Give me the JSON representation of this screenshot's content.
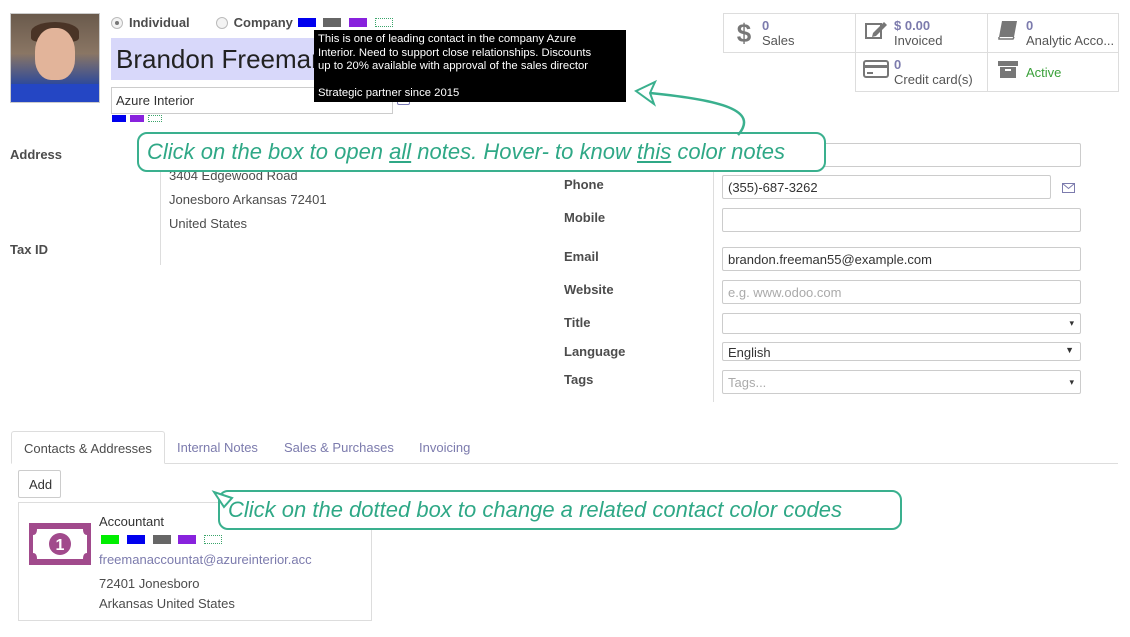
{
  "contact": {
    "type_individual": "Individual",
    "type_company": "Company",
    "name": "Brandon Freeman",
    "company": "Azure Interior",
    "tag_colors": [
      "#0000ee",
      "#666666",
      "#8822dd"
    ],
    "small_tag_colors": [
      "#0000ee",
      "#8822dd"
    ]
  },
  "tooltip": {
    "line1": "This is one of leading contact in the company Azure",
    "line2": "Interior. Need to support close relationships. Discounts",
    "line3": "up to 20% available with approval of the sales director",
    "line4": "Strategic partner since 2015"
  },
  "stats": {
    "sales": {
      "value": "0",
      "label": "Sales",
      "icon": "dollar-icon"
    },
    "invoiced": {
      "value": "$ 0.00",
      "label": "Invoiced",
      "icon": "edit-icon"
    },
    "analytic": {
      "value": "0",
      "label": "Analytic Acco...",
      "icon": "book-icon"
    },
    "credit": {
      "value": "0",
      "label": "Credit card(s)",
      "icon": "credit-card-icon"
    },
    "active": {
      "label": "Active",
      "icon": "archive-icon"
    }
  },
  "form": {
    "address_label": "Address",
    "address_street": "3404 Edgewood Road",
    "address_city": "Jonesboro  Arkansas  72401",
    "address_country": "United States",
    "taxid_label": "Tax ID",
    "phone_label": "Phone",
    "phone_value": "(355)-687-3262",
    "mobile_label": "Mobile",
    "email_label": "Email",
    "email_value": "brandon.freeman55@example.com",
    "website_label": "Website",
    "website_placeholder": "e.g. www.odoo.com",
    "title_label": "Title",
    "language_label": "Language",
    "language_value": "English",
    "tags_label": "Tags",
    "tags_placeholder": "Tags..."
  },
  "tabs": [
    "Contacts & Addresses",
    "Internal Notes",
    "Sales & Purchases",
    "Invoicing"
  ],
  "add_label": "Add",
  "card": {
    "title": "Accountant",
    "email": "freemanaccountat@azureinterior.acc",
    "line1": "72401 Jonesboro",
    "line2": "Arkansas United States",
    "tag_colors": [
      "#00ee00",
      "#0000ee",
      "#666666",
      "#8822dd"
    ]
  },
  "callouts": {
    "top_pre": "Click on the box to open ",
    "top_u1": "all",
    "top_mid": " notes. Hover- to know ",
    "top_u2": "this",
    "top_post": " color notes",
    "bottom": "Click on the dotted box to change a related contact color codes"
  }
}
